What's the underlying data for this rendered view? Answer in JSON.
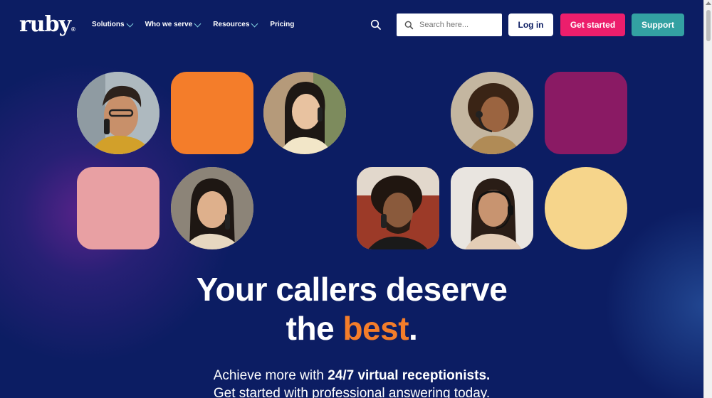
{
  "header": {
    "logo": "ruby",
    "logo_mark": "®",
    "nav": [
      {
        "label": "Solutions",
        "has_dropdown": true
      },
      {
        "label": "Who we serve",
        "has_dropdown": true
      },
      {
        "label": "Resources",
        "has_dropdown": true
      },
      {
        "label": "Pricing",
        "has_dropdown": false
      }
    ],
    "search": {
      "placeholder": "Search here..."
    },
    "login_label": "Log in",
    "get_started_label": "Get started",
    "support_label": "Support"
  },
  "hero": {
    "headline_line1": "Your callers deserve",
    "headline_line2_start": "the ",
    "headline_line2_accent": "best",
    "headline_line2_end": ".",
    "sub_line1_start": "Achieve more with ",
    "sub_line1_bold": "24/7 virtual receptionists.",
    "sub_line2": "Get started with professional answering today."
  },
  "colors": {
    "background": "#0c1d63",
    "accent_orange": "#f47d2a",
    "cta_pink": "#ec1e6c",
    "support_teal": "#33a1a2",
    "tile_orange": "#f47d2a",
    "tile_plum": "#8a1a64",
    "tile_pink": "#e8a0a3",
    "tile_yellow": "#f6d58b"
  }
}
